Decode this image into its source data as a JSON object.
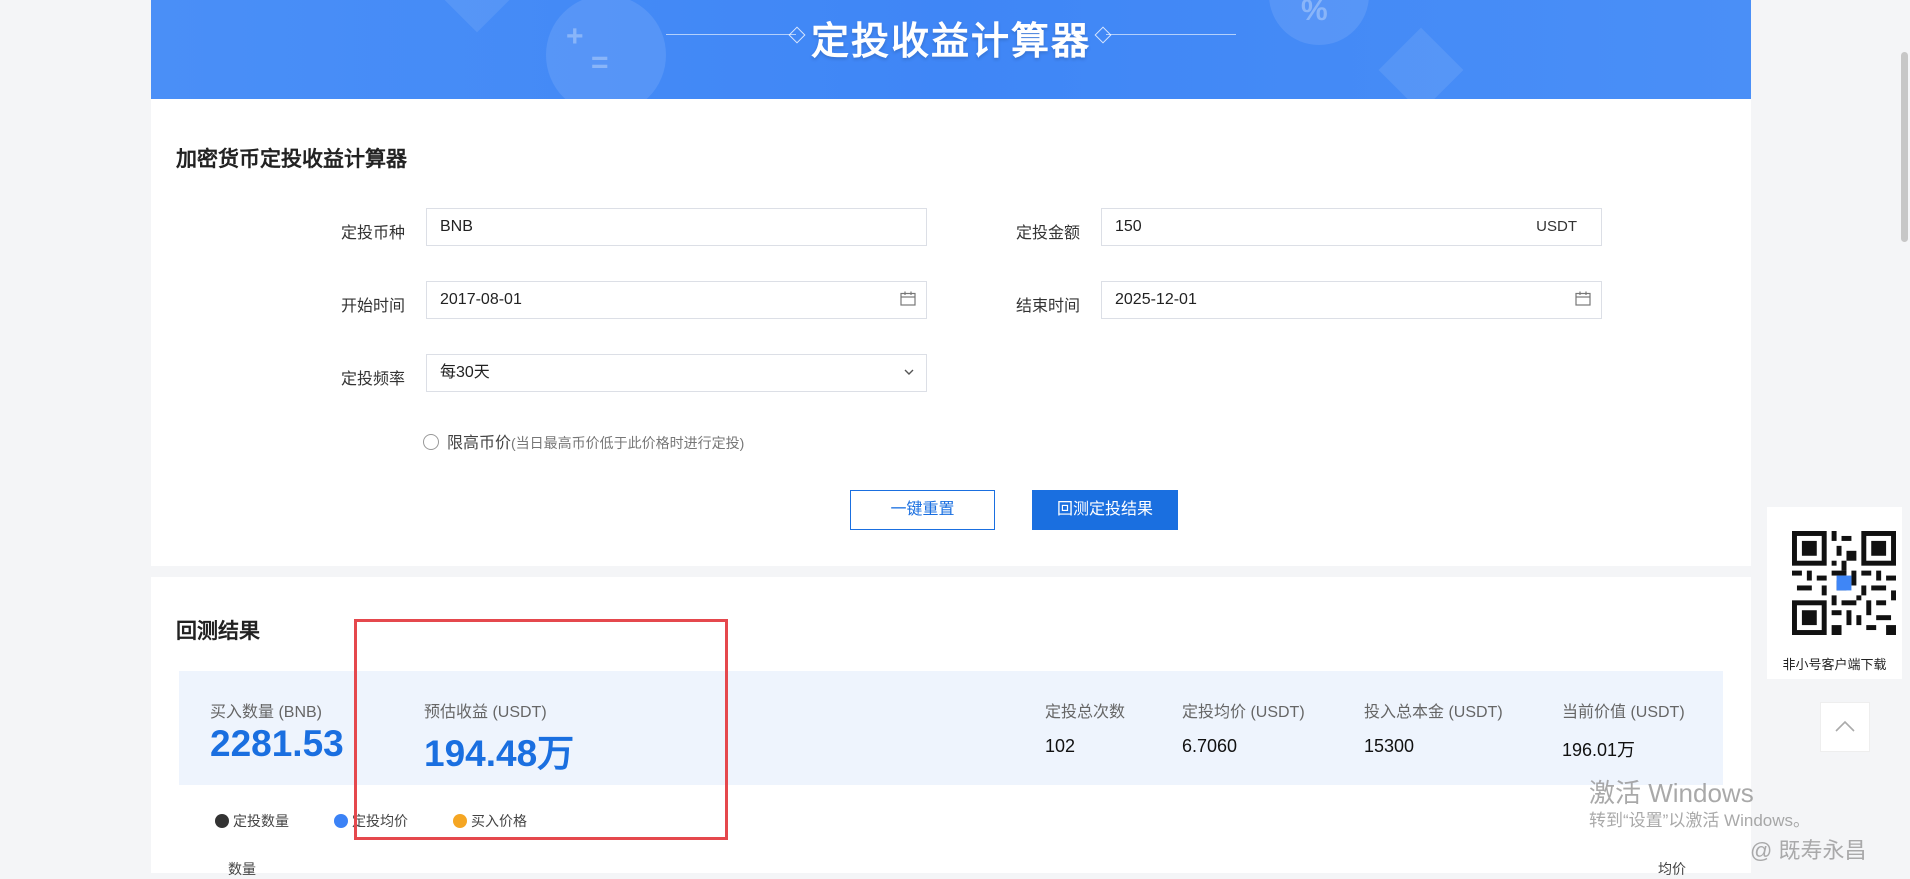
{
  "banner": {
    "title": "定投收益计算器"
  },
  "form": {
    "section_title": "加密货币定投收益计算器",
    "coin": {
      "label": "定投币种",
      "value": "BNB"
    },
    "amount": {
      "label": "定投金额",
      "value": "150",
      "unit": "USDT"
    },
    "start_date": {
      "label": "开始时间",
      "value": "2017-08-01"
    },
    "end_date": {
      "label": "结束时间",
      "value": "2025-12-01"
    },
    "frequency": {
      "label": "定投频率",
      "value": "每30天"
    },
    "limit_price": {
      "label": "限高币价",
      "hint": "(当日最高币价低于此价格时进行定投)",
      "checked": false
    },
    "reset_button": "一键重置",
    "submit_button": "回测定投结果"
  },
  "result": {
    "section_title": "回测结果",
    "buy_qty": {
      "label": "买入数量 (BNB)",
      "value": "2281.53"
    },
    "est_profit": {
      "label": "预估收益 (USDT)",
      "value": "194.48万"
    },
    "total_count": {
      "label": "定投总次数",
      "value": "102"
    },
    "avg_price": {
      "label": "定投均价 (USDT)",
      "value": "6.7060"
    },
    "total_principal": {
      "label": "投入总本金 (USDT)",
      "value": "15300"
    },
    "current_value": {
      "label": "当前价值 (USDT)",
      "value": "196.01万"
    },
    "legend": [
      {
        "label": "定投数量",
        "color": "#333333"
      },
      {
        "label": "定投均价",
        "color": "#3b82f6"
      },
      {
        "label": "买入价格",
        "color": "#f5a623"
      }
    ],
    "axis_left": "数量",
    "axis_right": "均价"
  },
  "sidebar": {
    "qr_caption": "非小号客户端下载"
  },
  "watermark": {
    "title": "激活 Windows",
    "subtitle": "转到“设置”以激活 Windows。",
    "author": "@ 既寿永昌"
  },
  "colors": {
    "accent": "#1a6fe0",
    "banner": "#3f86f6",
    "highlight": "#e5484d"
  }
}
